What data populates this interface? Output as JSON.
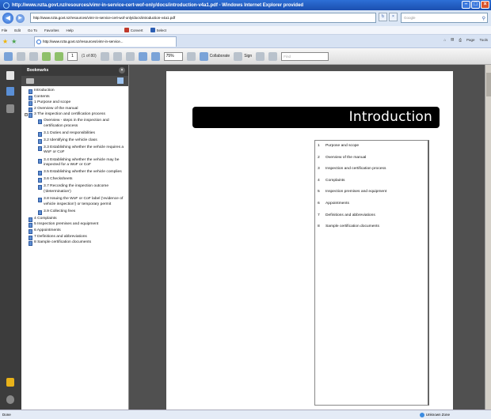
{
  "window": {
    "title": "http://www.nzta.govt.nz/resources/vimr-in-service-cert-wof-only/docs/introduction-v4a1.pdf - Windows Internet Explorer provided",
    "minimize": "–",
    "maximize": "□",
    "close": "×"
  },
  "addressbar": {
    "url": "http://www.nzta.govt.nz/resources/vimr-in-service-cert-wof-only/docs/introduction-v4a1.pdf",
    "refresh": "↻",
    "stop": "×",
    "search_placeholder": "Google"
  },
  "menu": {
    "items": [
      "File",
      "Edit",
      "Go To",
      "Favorites",
      "Help"
    ],
    "convert": "Convert",
    "select": "Select"
  },
  "tab": {
    "label": "http://www.nzta.govt.nz/resources/vimr-in-service..."
  },
  "tabtools": {
    "page": "Page",
    "tools": "Tools"
  },
  "acrobat": {
    "page_number": "1",
    "page_count": "(1 of 80)",
    "zoom": "75%",
    "collaborate": "Collaborate",
    "sign": "Sign",
    "find_placeholder": "Find"
  },
  "bookmarks": {
    "header": "Bookmarks",
    "items": [
      {
        "label": "Introduction",
        "level": 0
      },
      {
        "label": "Contents",
        "level": 0
      },
      {
        "label": "1 Purpose and scope",
        "level": 0
      },
      {
        "label": "2 Overview of the manual",
        "level": 0
      },
      {
        "label": "3 The inspection and certification process",
        "level": 0
      },
      {
        "label": "Overview - steps in the inspection and certification process",
        "level": 1
      },
      {
        "label": "3.1 Duties and responsibilities",
        "level": 1
      },
      {
        "label": "3.2 Identifying the vehicle class",
        "level": 1
      },
      {
        "label": "3.3 Establishing whether the vehicle requires a WoF or CoF",
        "level": 1
      },
      {
        "label": "3.4 Establishing whether the vehicle may be inspected for a WoF or CoF",
        "level": 1
      },
      {
        "label": "3.5 Establishing whether the vehicle complies",
        "level": 1
      },
      {
        "label": "3.6 Checksheets",
        "level": 1
      },
      {
        "label": "3.7 Recording the inspection outcome ('determination')",
        "level": 1
      },
      {
        "label": "3.8 Issuing the WoF or CoF label ('evidence of vehicle inspection') or temporary permit",
        "level": 1
      },
      {
        "label": "3.9 Collecting fees",
        "level": 1
      },
      {
        "label": "4 Complaints",
        "level": 0
      },
      {
        "label": "5 Inspection premises and equipment",
        "level": 0
      },
      {
        "label": "6 Appointments",
        "level": 0
      },
      {
        "label": "7 Definitions and abbreviations",
        "level": 0
      },
      {
        "label": "8 Sample certification documents",
        "level": 0
      }
    ]
  },
  "document": {
    "title": "Introduction",
    "toc": [
      {
        "num": "1",
        "label": "Purpose and scope"
      },
      {
        "num": "2",
        "label": "Overview of the manual"
      },
      {
        "num": "3",
        "label": "Inspection and certification process"
      },
      {
        "num": "4",
        "label": "Complaints"
      },
      {
        "num": "5",
        "label": "Inspection premises and equipment"
      },
      {
        "num": "6",
        "label": "Appointments"
      },
      {
        "num": "7",
        "label": "Definitions and abbreviations"
      },
      {
        "num": "8",
        "label": "Sample certification documents"
      }
    ]
  },
  "statusbar": {
    "left": "Done",
    "zone": "Unknown Zone"
  }
}
